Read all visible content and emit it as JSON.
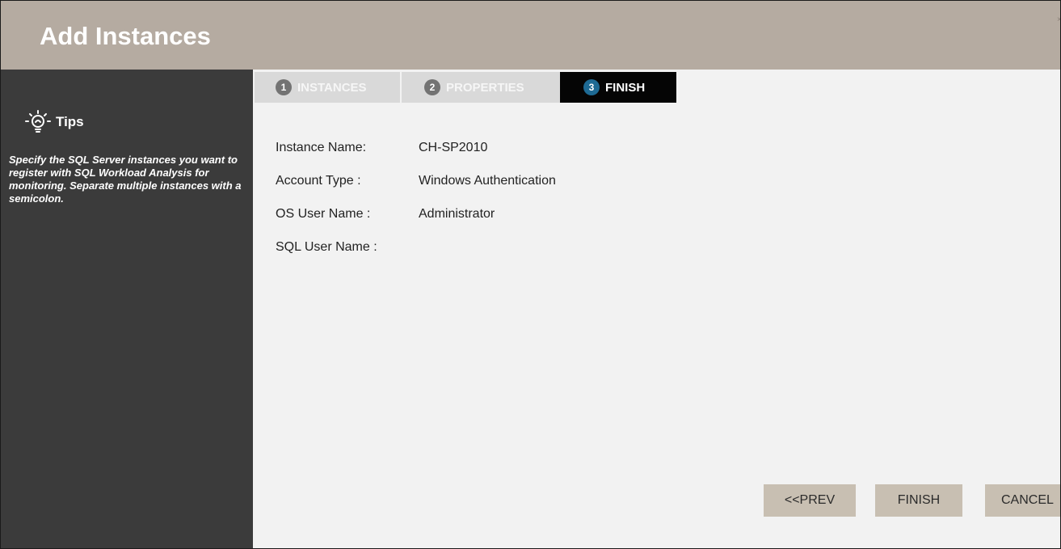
{
  "dialog": {
    "title": "Add Instances",
    "close_glyph": "×"
  },
  "sidebar": {
    "tips_icon": "lightbulb-icon",
    "tips_title": "Tips",
    "tips_text": "Specify the SQL Server instances you want to register with SQL Workload Analysis for monitoring. Separate multiple instances with a semicolon."
  },
  "steps": [
    {
      "number": "1",
      "label": "INSTANCES",
      "state": "inactive"
    },
    {
      "number": "2",
      "label": "PROPERTIES",
      "state": "inactive"
    },
    {
      "number": "3",
      "label": "FINISH",
      "state": "active"
    }
  ],
  "summary": {
    "instance_name_label": "Instance Name:",
    "instance_name_value": "CH-SP2010",
    "account_type_label": "Account Type :",
    "account_type_value": "Windows Authentication",
    "os_user_label": "OS User Name :",
    "os_user_value": "Administrator",
    "sql_user_label": "SQL User Name :",
    "sql_user_value": ""
  },
  "buttons": {
    "prev": "<<PREV",
    "finish": "FINISH",
    "cancel": "CANCEL"
  },
  "colors": {
    "titlebar": "#b5aba1",
    "sidebar": "#3b3b3b",
    "step_active_bg": "#050505",
    "step_active_badge": "#1e6a94",
    "step_inactive_bg": "#d9d9d9",
    "button_bg": "#c8bfb2"
  }
}
